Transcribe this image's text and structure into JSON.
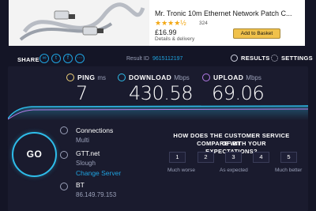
{
  "ad": {
    "title": "Mr. Tronic 10m Ethernet Network Patch C...",
    "stars": "★★★★½",
    "rating_count": "324",
    "price": "£16.99",
    "subtitle": "Details & delivery",
    "button": "Add to Basket"
  },
  "toolbar": {
    "share_label": "SHARE",
    "share_icons": [
      "link-icon",
      "twitter-icon",
      "facebook-icon",
      "more-icon"
    ],
    "result_label": "Result ID",
    "result_id": "9615112197",
    "results_label": "RESULTS",
    "settings_label": "SETTINGS"
  },
  "metrics": {
    "ping": {
      "label": "PING",
      "unit": "ms",
      "value": "7",
      "color": "#f0d27a"
    },
    "download": {
      "label": "DOWNLOAD",
      "unit": "Mbps",
      "value": "430.58",
      "color": "#2ebdea"
    },
    "upload": {
      "label": "UPLOAD",
      "unit": "Mbps",
      "value": "69.06",
      "color": "#b57be8"
    }
  },
  "go_label": "GO",
  "connection": {
    "title": "Connections",
    "mode": "Multi",
    "server_name": "GTT.net",
    "server_location": "Slough",
    "change_server": "Change Server",
    "isp_name": "BT",
    "isp_ip": "86.149.79.153"
  },
  "survey": {
    "question_line1": "HOW DOES THE CUSTOMER SERVICE OF BT",
    "question_line2": "COMPARE WITH YOUR EXPECTATIONS?",
    "options": [
      "1",
      "2",
      "3",
      "4",
      "5"
    ],
    "scale_low": "Much worse",
    "scale_mid": "As expected",
    "scale_high": "Much better"
  },
  "colors": {
    "accent": "#1fa3e0",
    "background": "#141526",
    "panel": "#1a1b2e"
  }
}
